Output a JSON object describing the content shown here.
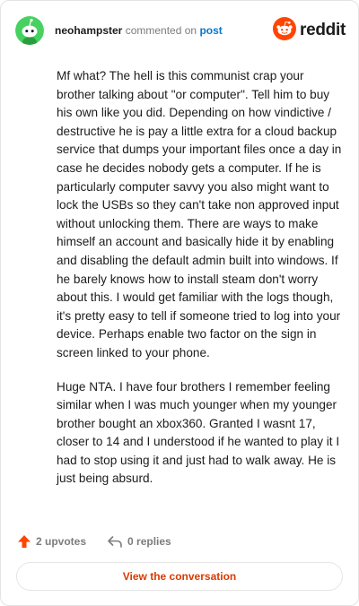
{
  "colors": {
    "username": "#1c1c1c",
    "meta_text": "#7c7c7c",
    "post_link": "#0079d3",
    "reddit_orange": "#ff4500",
    "button_text": "#d93a00",
    "avatar_bg": "#46d160"
  },
  "header": {
    "username": "neohampster",
    "action_text": "commented on",
    "post_link_label": "post",
    "avatar_icon": "snoo-avatar-icon",
    "brand_icon": "reddit-snoo-icon",
    "brand_name": "reddit"
  },
  "comment": {
    "paragraphs": [
      "Mf what? The hell is this communist crap your brother talking about \"or computer\". Tell him to buy his own like you did. Depending on how vindictive / destructive he is pay a little extra for a cloud backup service that dumps your important files once a day in case he decides nobody gets a computer. If he is particularly computer savvy you also might want to lock the USBs so they can't take non approved input without unlocking them. There are ways to make himself an account and basically hide it by enabling and disabling the default admin built into windows. If he barely knows how to install steam don't worry about this. I would get familiar with the logs though, it's pretty easy to tell if someone tried to log into your device. Perhaps enable two factor on the sign in screen linked to your phone.",
      "Huge NTA. I have four brothers I remember feeling similar when I was much younger when my younger brother bought an xbox360. Granted I wasnt 17, closer to 14 and I understood if he wanted to play it I had to stop using it and just had to walk away. He is just being absurd."
    ]
  },
  "footer": {
    "upvotes_label": "2 upvotes",
    "upvote_icon": "upvote-arrow-icon",
    "replies_label": "0 replies",
    "reply_icon": "reply-arrow-icon",
    "view_button_label": "View the conversation"
  }
}
